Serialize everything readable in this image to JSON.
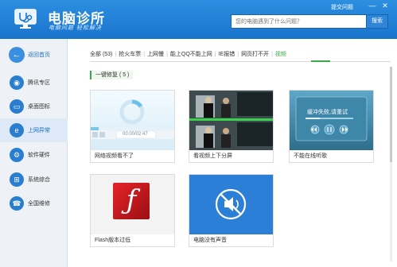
{
  "header": {
    "title": "电脑诊所",
    "slogan": "电脑问题  轻松解决",
    "report_link": "提交问题",
    "minimize_glyph": "—",
    "close_glyph": "✕",
    "search": {
      "placeholder": "您的电脑遇到了什么问题？",
      "button_label": "搜索"
    }
  },
  "sidebar": {
    "back_label": "返回首页",
    "items": [
      {
        "label": "腾讯专区",
        "icon": "qq-penguin-icon",
        "glyph": "◉"
      },
      {
        "label": "桌面图标",
        "icon": "monitor-icon",
        "glyph": "▭"
      },
      {
        "label": "上网异常",
        "icon": "ie-browser-icon",
        "glyph": "e"
      },
      {
        "label": "软件硬件",
        "icon": "gear-icon",
        "glyph": "⚙"
      },
      {
        "label": "系统综合",
        "icon": "windows-icon",
        "glyph": "⊞"
      },
      {
        "label": "全国维修",
        "icon": "phone-icon",
        "glyph": "☎"
      }
    ],
    "active_index": 2
  },
  "tabs": {
    "items": [
      "全部 (53)",
      "抢火车票",
      "上网慢",
      "能上QQ不能上网",
      "IE报错",
      "网页打不开",
      "视频"
    ],
    "active_index": 6
  },
  "section": {
    "label": "一键修复 ( 5 )"
  },
  "cards": [
    {
      "caption": "网络视频看不了",
      "thumb": "video-player",
      "time_text": "00:00/02:47"
    },
    {
      "caption": "看视频上下分屏",
      "thumb": "split-screen-video"
    },
    {
      "caption": "不能在线听歌",
      "thumb": "music-player",
      "overlay_text": "缓冲失败,请重试"
    },
    {
      "caption": "Flash版本过低",
      "thumb": "flash-logo",
      "glyph": "ƒ"
    },
    {
      "caption": "电脑没有声音",
      "thumb": "mute-speaker"
    }
  ],
  "colors": {
    "header_blue": "#1f7fd6",
    "accent_green": "#3aa84a",
    "sidebar_bg": "#eef1f5",
    "flash_red": "#c8141a",
    "mute_blue": "#2b7fd6"
  }
}
